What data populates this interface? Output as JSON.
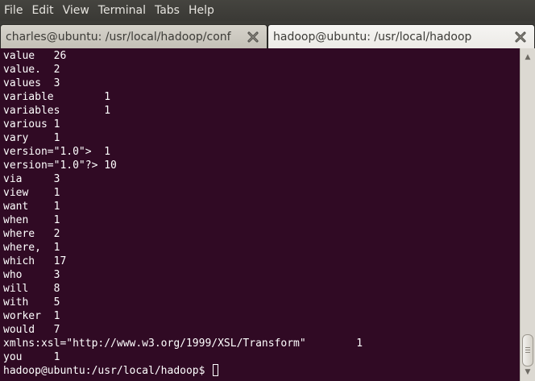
{
  "menu": [
    "File",
    "Edit",
    "View",
    "Terminal",
    "Tabs",
    "Help"
  ],
  "tabs": [
    {
      "label": "charles@ubuntu: /usr/local/hadoop/conf",
      "active": false
    },
    {
      "label": "hadoop@ubuntu: /usr/local/hadoop",
      "active": true
    }
  ],
  "terminal": {
    "lines": [
      "value   26",
      "value.  2",
      "values  3",
      "variable        1",
      "variables       1",
      "various 1",
      "vary    1",
      "version=\"1.0\">  1",
      "version=\"1.0\"?> 10",
      "via     3",
      "view    1",
      "want    1",
      "when    1",
      "where   2",
      "where,  1",
      "which   17",
      "who     3",
      "will    8",
      "with    5",
      "worker  1",
      "would   7",
      "xmlns:xsl=\"http://www.w3.org/1999/XSL/Transform\"        1",
      "you     1"
    ],
    "prompt": "hadoop@ubuntu:/usr/local/hadoop$ "
  },
  "colors": {
    "terminal_bg": "#300a24",
    "terminal_fg": "#ffffff",
    "chrome": "#3c3b37"
  },
  "icons": {
    "tab_close": "close-icon",
    "scroll_up": "arrow-up-icon",
    "scroll_down": "arrow-down-icon"
  }
}
